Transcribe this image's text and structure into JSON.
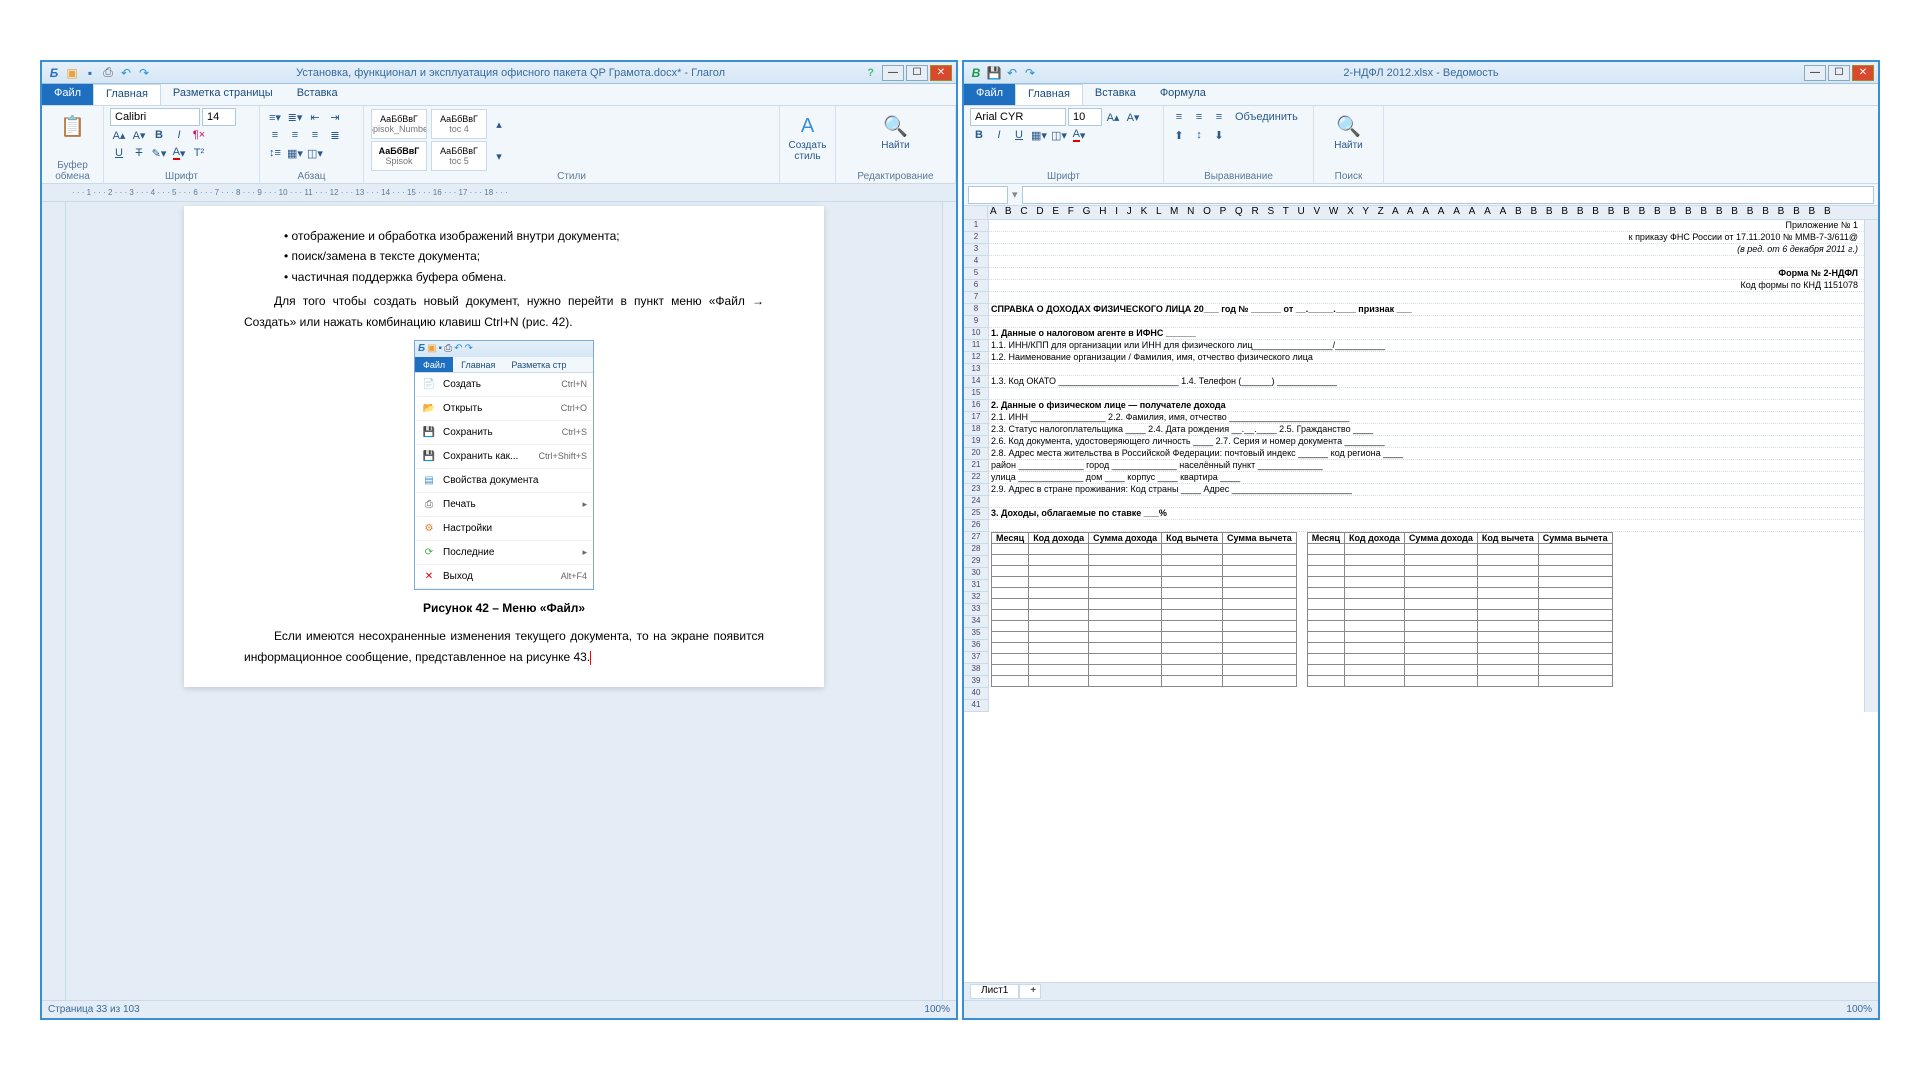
{
  "left": {
    "title": "Установка, функционал и эксплуатация офисного пакета QP Грамота.docx* - Глагол",
    "menu": {
      "file": "Файл",
      "home": "Главная",
      "layout": "Разметка страницы",
      "insert": "Вставка"
    },
    "font_name": "Calibri",
    "font_size": "14",
    "groups": {
      "clipboard": "Буфер обмена",
      "font": "Шрифт",
      "paragraph": "Абзац",
      "styles": "Стили",
      "edit": "Редактирование"
    },
    "styles": {
      "s1a": "АаБбВвГ",
      "s1b": "АаБбВвГ",
      "s2a": "АаБбВвГ",
      "s2b": "АаБбВвГ",
      "t1": "Spisok_Number",
      "t2": "toc 4",
      "t3": "Spisok",
      "t4": "toc 5"
    },
    "create_style": "Создать\nстиль",
    "find": "Найти",
    "ruler": "· · · 1 · · · 2 · · · 3 · · · 4 · · · 5 · · · 6 · · · 7 · · · 8 · · · 9 · · · 10 · · · 11 · · · 12 · · · 13 · · · 14 · · · 15 · · · 16 · · · 17 · · · 18 · · ·",
    "doc": {
      "b1": "отображение и обработка изображений внутри документа;",
      "b2": "поиск/замена в тексте документа;",
      "b3": "частичная поддержка буфера обмена.",
      "p1": "Для того чтобы создать новый документ, нужно перейти в пункт меню «Файл → Создать» или нажать комбинацию клавиш Ctrl+N (рис. 42).",
      "caption": "Рисунок 42 – Меню «Файл»",
      "p2": "Если имеются несохраненные изменения текущего документа, то на экране появится информационное сообщение, представленное на рисунке 43.",
      "embedded": {
        "file": "Файл",
        "home": "Главная",
        "layout": "Разметка стр",
        "items": {
          "create": "Создать",
          "create_sc": "Ctrl+N",
          "open": "Открыть",
          "open_sc": "Ctrl+O",
          "save": "Сохранить",
          "save_sc": "Ctrl+S",
          "saveas": "Сохранить как...",
          "saveas_sc": "Ctrl+Shift+S",
          "props": "Свойства документа",
          "print": "Печать",
          "settings": "Настройки",
          "recent": "Последние",
          "exit": "Выход",
          "exit_sc": "Alt+F4"
        }
      }
    },
    "status_left": "Страница 33 из 103",
    "status_right": "100%"
  },
  "right": {
    "title": "2-НДФЛ 2012.xlsx - Ведомость",
    "menu": {
      "file": "Файл",
      "home": "Главная",
      "insert": "Вставка",
      "formula": "Формула"
    },
    "font_name": "Arial CYR",
    "font_size": "10",
    "merge": "Объединить",
    "find": "Найти",
    "groups": {
      "font": "Шрифт",
      "align": "Выравнивание",
      "search": "Поиск"
    },
    "colheads": "A B C D E F G H I J K L M N O P Q R S T U V W X Y Z A А А А А А А А В В В В В В В В В В В В В В В В В В В В В",
    "rows": {
      "r1": "Приложение № 1",
      "r2": "к приказу ФНС России от 17.11.2010 № ММВ-7-3/611@",
      "r3": "(в ред. от 6 декабря 2011 г.)",
      "r5": "Форма № 2-НДФЛ",
      "r6": "Код формы по КНД 1151078",
      "r8": "СПРАВКА О ДОХОДАХ ФИЗИЧЕСКОГО ЛИЦА 20___ год  № ______ от __._____.____     признак ___",
      "r10": "1. Данные о налоговом агенте                                                          в ИФНС ______",
      "r11": "1.1. ИНН/КПП для организации или ИНН для физического лиц________________/__________",
      "r12": "1.2. Наименование организации / Фамилия, имя, отчество физического лица",
      "r14": "1.3. Код ОКАТО ________________________                      1.4. Телефон    (______) ____________",
      "r16": "2. Данные о физическом лице — получателе дохода",
      "r17": "2.1. ИНН _______________   2.2. Фамилия, имя, отчество ________________________",
      "r18": "2.3. Статус налогоплательщика ____   2.4. Дата рождения __.__.____   2.5. Гражданство ____",
      "r19": "2.6. Код документа, удостоверяющего личность ____   2.7. Серия и номер документа ________",
      "r20": "2.8. Адрес места жительства в Российской Федерации:   почтовый индекс ______   код региона ____",
      "r21": "      район _____________   город _____________   населённый пункт _____________",
      "r22": "      улица _____________   дом ____   корпус ____   квартира ____",
      "r23": "2.9. Адрес в стране проживания:   Код страны ____   Адрес ________________________",
      "r25": "3. Доходы, облагаемые по ставке ___%"
    },
    "income_headers": {
      "month": "Месяц",
      "code_income": "Код дохода",
      "sum_income": "Сумма дохода",
      "code_ded": "Код вычета",
      "sum_ded": "Сумма вычета"
    },
    "sheet_tab": "Лист1",
    "status_right": "100%"
  }
}
